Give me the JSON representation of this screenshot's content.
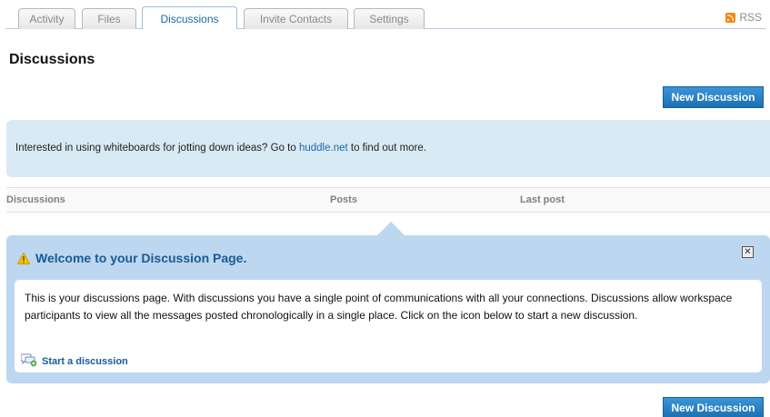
{
  "tabs": [
    {
      "label": "Activity",
      "active": false
    },
    {
      "label": "Files",
      "active": false
    },
    {
      "label": "Discussions",
      "active": true
    },
    {
      "label": "Invite Contacts",
      "active": false
    },
    {
      "label": "Settings",
      "active": false
    }
  ],
  "rss": {
    "label": "RSS",
    "icon": "rss-icon"
  },
  "page": {
    "title": "Discussions"
  },
  "buttons": {
    "new_discussion_top": "New Discussion",
    "new_discussion_bottom": "New Discussion"
  },
  "info": {
    "text_before": "Interested in using whiteboards for jotting down ideas? Go to ",
    "link_text": "huddle.net",
    "text_after": " to find out more."
  },
  "table": {
    "columns": [
      "Discussions",
      "Posts",
      "Last post"
    ]
  },
  "welcome": {
    "title": "Welcome to your Discussion Page.",
    "body": "This is your discussions page. With discussions you have a single point of communications with all your connections. Discussions allow workspace participants to view all the messages posted chronologically in a single place. Click on the icon below to start a new discussion.",
    "start_link": "Start a discussion",
    "close_glyph": "✕"
  },
  "colors": {
    "accent": "#1a6aa8",
    "button": "#2a82c6",
    "info_bg": "#d8eaf4",
    "welcome_bg": "#bcd7ef"
  }
}
